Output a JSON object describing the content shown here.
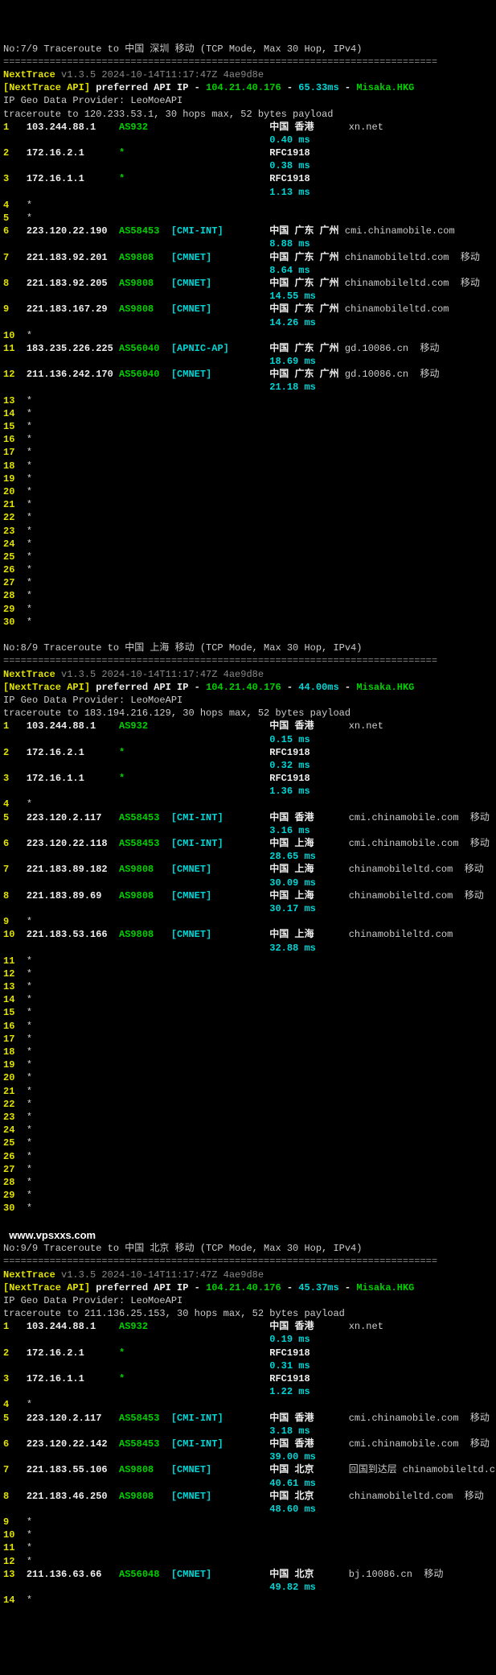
{
  "colors": {
    "yellow": "#e2e200",
    "green": "#00d000",
    "cyan": "#00d6d6",
    "white": "#eee",
    "grey": "#888"
  },
  "sep": "===========================================================================",
  "watermark": "www.vpsxxs.com",
  "blocks": [
    {
      "title": "No:7/9 Traceroute to 中国 深圳 移动 (TCP Mode, Max 30 Hop, IPv4)",
      "hdr_left": "NextTrace ",
      "hdr_right": "v1.3.5 2024-10-14T11:17:47Z 4ae9d8e",
      "api_left": "[NextTrace API]",
      "api_mid": " preferred API IP - ",
      "api_ip": "104.21.40.176",
      "api_sep1": " - ",
      "api_ping": "65.33ms",
      "api_sep2": " - ",
      "api_loc": "Misaka.HKG",
      "geo": "IP Geo Data Provider: LeoMoeAPI",
      "tgt": "traceroute to 120.233.53.1, 30 hops max, 52 bytes payload",
      "hops": [
        {
          "n": "1",
          "ip": "103.244.88.1",
          "asn": "AS932",
          "net": "",
          "loc": "中国 香港",
          "dom": "xn.net",
          "isp": "",
          "ms": "0.40 ms"
        },
        {
          "n": "2",
          "ip": "172.16.2.1",
          "asn": "*",
          "net": "",
          "loc": "RFC1918",
          "dom": "",
          "isp": "",
          "ms": "0.38 ms"
        },
        {
          "n": "3",
          "ip": "172.16.1.1",
          "asn": "*",
          "net": "",
          "loc": "RFC1918",
          "dom": "",
          "isp": "",
          "ms": "1.13 ms"
        },
        {
          "n": "4",
          "ip": "*",
          "asn": "",
          "net": "",
          "loc": "",
          "dom": "",
          "isp": "",
          "ms": ""
        },
        {
          "n": "5",
          "ip": "*",
          "asn": "",
          "net": "",
          "loc": "",
          "dom": "",
          "isp": "",
          "ms": ""
        },
        {
          "n": "6",
          "ip": "223.120.22.190",
          "asn": "AS58453",
          "net": "[CMI-INT]",
          "loc": "中国 广东 广州",
          "dom": "cmi.chinamobile.com",
          "isp": "",
          "ms": "8.88 ms"
        },
        {
          "n": "7",
          "ip": "221.183.92.201",
          "asn": "AS9808",
          "net": "[CMNET]",
          "loc": "中国 广东 广州",
          "dom": "chinamobileltd.com",
          "isp": "移动",
          "ms": "8.64 ms"
        },
        {
          "n": "8",
          "ip": "221.183.92.205",
          "asn": "AS9808",
          "net": "[CMNET]",
          "loc": "中国 广东 广州",
          "dom": "chinamobileltd.com",
          "isp": "移动",
          "ms": "14.55 ms"
        },
        {
          "n": "9",
          "ip": "221.183.167.29",
          "asn": "AS9808",
          "net": "[CMNET]",
          "loc": "中国 广东 广州",
          "dom": "chinamobileltd.com",
          "isp": "",
          "ms": "14.26 ms"
        },
        {
          "n": "10",
          "ip": "*",
          "asn": "",
          "net": "",
          "loc": "",
          "dom": "",
          "isp": "",
          "ms": ""
        },
        {
          "n": "11",
          "ip": "183.235.226.225",
          "asn": "AS56040",
          "net": "[APNIC-AP]",
          "loc": "中国 广东 广州",
          "dom": "gd.10086.cn",
          "isp": "移动",
          "ms": "18.69 ms"
        },
        {
          "n": "12",
          "ip": "211.136.242.170",
          "asn": "AS56040",
          "net": "[CMNET]",
          "loc": "中国 广东 广州",
          "dom": "gd.10086.cn",
          "isp": "移动",
          "ms": "21.18 ms"
        },
        {
          "n": "13",
          "ip": "*"
        },
        {
          "n": "14",
          "ip": "*"
        },
        {
          "n": "15",
          "ip": "*"
        },
        {
          "n": "16",
          "ip": "*"
        },
        {
          "n": "17",
          "ip": "*"
        },
        {
          "n": "18",
          "ip": "*"
        },
        {
          "n": "19",
          "ip": "*"
        },
        {
          "n": "20",
          "ip": "*"
        },
        {
          "n": "21",
          "ip": "*"
        },
        {
          "n": "22",
          "ip": "*"
        },
        {
          "n": "23",
          "ip": "*"
        },
        {
          "n": "24",
          "ip": "*"
        },
        {
          "n": "25",
          "ip": "*"
        },
        {
          "n": "26",
          "ip": "*"
        },
        {
          "n": "27",
          "ip": "*"
        },
        {
          "n": "28",
          "ip": "*"
        },
        {
          "n": "29",
          "ip": "*"
        },
        {
          "n": "30",
          "ip": "*"
        }
      ]
    },
    {
      "title": "No:8/9 Traceroute to 中国 上海 移动 (TCP Mode, Max 30 Hop, IPv4)",
      "hdr_left": "NextTrace ",
      "hdr_right": "v1.3.5 2024-10-14T11:17:47Z 4ae9d8e",
      "api_left": "[NextTrace API]",
      "api_mid": " preferred API IP - ",
      "api_ip": "104.21.40.176",
      "api_sep1": " - ",
      "api_ping": "44.00ms",
      "api_sep2": " - ",
      "api_loc": "Misaka.HKG",
      "geo": "IP Geo Data Provider: LeoMoeAPI",
      "tgt": "traceroute to 183.194.216.129, 30 hops max, 52 bytes payload",
      "hops": [
        {
          "n": "1",
          "ip": "103.244.88.1",
          "asn": "AS932",
          "net": "",
          "loc": "中国 香港",
          "dom": "xn.net",
          "isp": "",
          "ms": "0.15 ms"
        },
        {
          "n": "2",
          "ip": "172.16.2.1",
          "asn": "*",
          "net": "",
          "loc": "RFC1918",
          "dom": "",
          "isp": "",
          "ms": "0.32 ms"
        },
        {
          "n": "3",
          "ip": "172.16.1.1",
          "asn": "*",
          "net": "",
          "loc": "RFC1918",
          "dom": "",
          "isp": "",
          "ms": "1.36 ms"
        },
        {
          "n": "4",
          "ip": "*",
          "asn": "",
          "net": "",
          "loc": "",
          "dom": "",
          "isp": "",
          "ms": ""
        },
        {
          "n": "5",
          "ip": "223.120.2.117",
          "asn": "AS58453",
          "net": "[CMI-INT]",
          "loc": "中国 香港",
          "dom": "cmi.chinamobile.com",
          "isp": "移动",
          "ms": "3.16 ms"
        },
        {
          "n": "6",
          "ip": "223.120.22.118",
          "asn": "AS58453",
          "net": "[CMI-INT]",
          "loc": "中国 上海",
          "dom": "cmi.chinamobile.com",
          "isp": "移动",
          "ms": "28.65 ms"
        },
        {
          "n": "7",
          "ip": "221.183.89.182",
          "asn": "AS9808",
          "net": "[CMNET]",
          "loc": "中国 上海",
          "dom": "chinamobileltd.com",
          "isp": "移动",
          "ms": "30.09 ms"
        },
        {
          "n": "8",
          "ip": "221.183.89.69",
          "asn": "AS9808",
          "net": "[CMNET]",
          "loc": "中国 上海",
          "dom": "chinamobileltd.com",
          "isp": "移动",
          "ms": "30.17 ms"
        },
        {
          "n": "9",
          "ip": "*",
          "asn": "",
          "net": "",
          "loc": "",
          "dom": "",
          "isp": "",
          "ms": ""
        },
        {
          "n": "10",
          "ip": "221.183.53.166",
          "asn": "AS9808",
          "net": "[CMNET]",
          "loc": "中国 上海",
          "dom": "chinamobileltd.com",
          "isp": "",
          "ms": "32.88 ms"
        },
        {
          "n": "11",
          "ip": "*"
        },
        {
          "n": "12",
          "ip": "*"
        },
        {
          "n": "13",
          "ip": "*"
        },
        {
          "n": "14",
          "ip": "*"
        },
        {
          "n": "15",
          "ip": "*"
        },
        {
          "n": "16",
          "ip": "*"
        },
        {
          "n": "17",
          "ip": "*"
        },
        {
          "n": "18",
          "ip": "*"
        },
        {
          "n": "19",
          "ip": "*"
        },
        {
          "n": "20",
          "ip": "*"
        },
        {
          "n": "21",
          "ip": "*"
        },
        {
          "n": "22",
          "ip": "*"
        },
        {
          "n": "23",
          "ip": "*"
        },
        {
          "n": "24",
          "ip": "*"
        },
        {
          "n": "25",
          "ip": "*"
        },
        {
          "n": "26",
          "ip": "*"
        },
        {
          "n": "27",
          "ip": "*"
        },
        {
          "n": "28",
          "ip": "*"
        },
        {
          "n": "29",
          "ip": "*"
        },
        {
          "n": "30",
          "ip": "*"
        }
      ]
    },
    {
      "title": "No:9/9 Traceroute to 中国 北京 移动 (TCP Mode, Max 30 Hop, IPv4)",
      "hdr_left": "NextTrace ",
      "hdr_right": "v1.3.5 2024-10-14T11:17:47Z 4ae9d8e",
      "api_left": "[NextTrace API]",
      "api_mid": " preferred API IP - ",
      "api_ip": "104.21.40.176",
      "api_sep1": " - ",
      "api_ping": "45.37ms",
      "api_sep2": " - ",
      "api_loc": "Misaka.HKG",
      "geo": "IP Geo Data Provider: LeoMoeAPI",
      "tgt": "traceroute to 211.136.25.153, 30 hops max, 52 bytes payload",
      "hops": [
        {
          "n": "1",
          "ip": "103.244.88.1",
          "asn": "AS932",
          "net": "",
          "loc": "中国 香港",
          "dom": "xn.net",
          "isp": "",
          "ms": "0.19 ms"
        },
        {
          "n": "2",
          "ip": "172.16.2.1",
          "asn": "*",
          "net": "",
          "loc": "RFC1918",
          "dom": "",
          "isp": "",
          "ms": "0.31 ms"
        },
        {
          "n": "3",
          "ip": "172.16.1.1",
          "asn": "*",
          "net": "",
          "loc": "RFC1918",
          "dom": "",
          "isp": "",
          "ms": "1.22 ms"
        },
        {
          "n": "4",
          "ip": "*",
          "asn": "",
          "net": "",
          "loc": "",
          "dom": "",
          "isp": "",
          "ms": ""
        },
        {
          "n": "5",
          "ip": "223.120.2.117",
          "asn": "AS58453",
          "net": "[CMI-INT]",
          "loc": "中国 香港",
          "dom": "cmi.chinamobile.com",
          "isp": "移动",
          "ms": "3.18 ms"
        },
        {
          "n": "6",
          "ip": "223.120.22.142",
          "asn": "AS58453",
          "net": "[CMI-INT]",
          "loc": "中国 香港",
          "dom": "cmi.chinamobile.com",
          "isp": "移动",
          "ms": "39.00 ms"
        },
        {
          "n": "7",
          "ip": "221.183.55.106",
          "asn": "AS9808",
          "net": "[CMNET]",
          "loc": "中国 北京",
          "dom": "回国到达层 chinamobileltd.com",
          "isp": "",
          "ms": "40.61 ms"
        },
        {
          "n": "8",
          "ip": "221.183.46.250",
          "asn": "AS9808",
          "net": "[CMNET]",
          "loc": "中国 北京",
          "dom": "chinamobileltd.com",
          "isp": "移动",
          "ms": "48.60 ms"
        },
        {
          "n": "9",
          "ip": "*"
        },
        {
          "n": "10",
          "ip": "*"
        },
        {
          "n": "11",
          "ip": "*"
        },
        {
          "n": "12",
          "ip": "*"
        },
        {
          "n": "13",
          "ip": "211.136.63.66",
          "asn": "AS56048",
          "net": "[CMNET]",
          "loc": "中国 北京",
          "dom": "bj.10086.cn",
          "isp": "移动",
          "ms": "49.82 ms"
        },
        {
          "n": "14",
          "ip": "*"
        }
      ]
    }
  ]
}
